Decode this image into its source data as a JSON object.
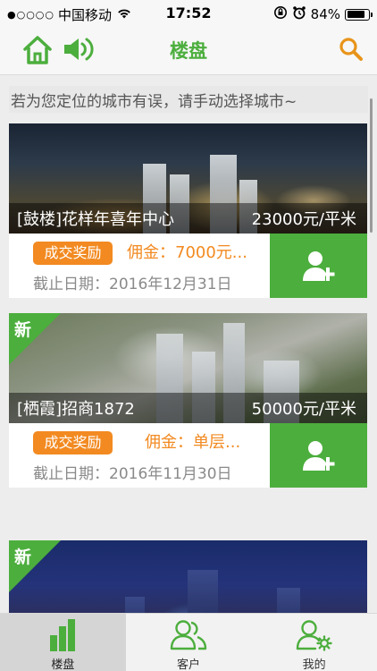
{
  "status_bar": {
    "signal_dots": "●○○○○",
    "carrier": "中国移动",
    "time": "17:52",
    "battery_percent": "84%",
    "battery_level": 0.84
  },
  "nav": {
    "title": "楼盘",
    "home_icon": "home-icon",
    "speaker_icon": "speaker-icon",
    "search_icon": "search-icon"
  },
  "tip": "若为您定位的城市有误，请手动选择城市~",
  "listings": [
    {
      "name": "[鼓楼]花样年喜年中心",
      "price": "23000元/平米",
      "badge": "",
      "reward_label": "成交奖励",
      "commission": "佣金：7000元...",
      "deadline": "截止日期：2016年12月31日"
    },
    {
      "name": "[栖霞]招商1872",
      "price": "50000元/平米",
      "badge": "新",
      "reward_label": "成交奖励",
      "commission": "佣金：单层...",
      "deadline": "截止日期：2016年11月30日"
    },
    {
      "name": "",
      "price": "",
      "badge": "新"
    }
  ],
  "tabs": [
    {
      "label": "楼盘",
      "icon": "building-chart-icon",
      "active": true
    },
    {
      "label": "客户",
      "icon": "customers-icon",
      "active": false
    },
    {
      "label": "我的",
      "icon": "user-settings-icon",
      "active": false
    }
  ],
  "colors": {
    "brand_green": "#4cae3d",
    "reward_orange": "#f28a21",
    "search_orange": "#e8941a"
  }
}
